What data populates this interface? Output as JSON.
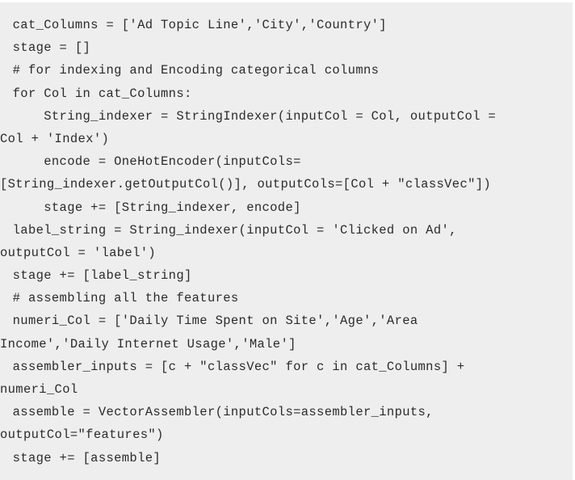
{
  "code_block": {
    "language": "python",
    "background_color": "#eeeeee",
    "text_color": "#2b2b2b",
    "page_background": "#ffffff",
    "lines": [
      {
        "text": " cat_Columns = ['Ad Topic Line','City','Country']",
        "continuation": false
      },
      {
        "text": " stage = []",
        "continuation": false
      },
      {
        "text": " # for indexing and Encoding categorical columns",
        "continuation": false
      },
      {
        "text": " for Col in cat_Columns:",
        "continuation": false
      },
      {
        "text": "     String_indexer = StringIndexer(inputCol = Col, outputCol =",
        "continuation": false
      },
      {
        "text": "Col + 'Index')",
        "continuation": true
      },
      {
        "text": "     encode = OneHotEncoder(inputCols=",
        "continuation": false
      },
      {
        "text": "[String_indexer.getOutputCol()], outputCols=[Col + \"classVec\"])",
        "continuation": true
      },
      {
        "text": "     stage += [String_indexer, encode]",
        "continuation": false
      },
      {
        "text": " label_string = String_indexer(inputCol = 'Clicked on Ad',",
        "continuation": false
      },
      {
        "text": "outputCol = 'label')",
        "continuation": true
      },
      {
        "text": " stage += [label_string]",
        "continuation": false
      },
      {
        "text": " # assembling all the features",
        "continuation": false
      },
      {
        "text": " numeri_Col = ['Daily Time Spent on Site','Age','Area",
        "continuation": false
      },
      {
        "text": "Income','Daily Internet Usage','Male']",
        "continuation": true
      },
      {
        "text": " assembler_inputs = [c + \"classVec\" for c in cat_Columns] +",
        "continuation": false
      },
      {
        "text": "numeri_Col",
        "continuation": true
      },
      {
        "text": " assemble = VectorAssembler(inputCols=assembler_inputs,",
        "continuation": false
      },
      {
        "text": "outputCol=\"features\")",
        "continuation": true
      },
      {
        "text": " stage += [assemble]",
        "continuation": false
      }
    ]
  }
}
